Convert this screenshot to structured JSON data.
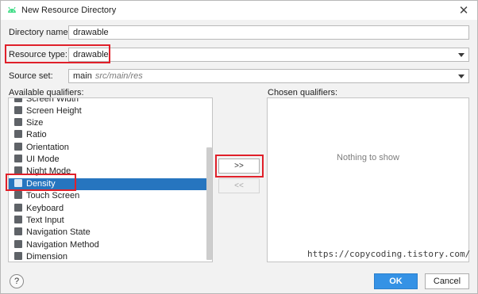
{
  "window": {
    "title": "New Resource Directory",
    "close_glyph": "✕"
  },
  "form": {
    "directory_name": {
      "label": "Directory name:",
      "value": "drawable"
    },
    "resource_type": {
      "label": "Resource type:",
      "value": "drawable"
    },
    "source_set": {
      "label": "Source set:",
      "value": "main",
      "hint": "src/main/res"
    }
  },
  "available": {
    "label": "Available qualifiers:",
    "items": [
      {
        "label": "Screen Width",
        "icon": "screen-width-icon"
      },
      {
        "label": "Screen Height",
        "icon": "screen-height-icon"
      },
      {
        "label": "Size",
        "icon": "size-icon"
      },
      {
        "label": "Ratio",
        "icon": "ratio-icon"
      },
      {
        "label": "Orientation",
        "icon": "orientation-icon"
      },
      {
        "label": "UI Mode",
        "icon": "ui-mode-icon"
      },
      {
        "label": "Night Mode",
        "icon": "night-mode-icon"
      },
      {
        "label": "Density",
        "icon": "density-icon",
        "selected": true
      },
      {
        "label": "Touch Screen",
        "icon": "touch-screen-icon"
      },
      {
        "label": "Keyboard",
        "icon": "keyboard-icon"
      },
      {
        "label": "Text Input",
        "icon": "text-input-icon"
      },
      {
        "label": "Navigation State",
        "icon": "navigation-state-icon"
      },
      {
        "label": "Navigation Method",
        "icon": "navigation-method-icon"
      },
      {
        "label": "Dimension",
        "icon": "dimension-icon"
      }
    ]
  },
  "transfer": {
    "add_label": ">>",
    "remove_label": "<<"
  },
  "chosen": {
    "label": "Chosen qualifiers:",
    "empty_text": "Nothing to show",
    "watermark": "https://copycoding.tistory.com/"
  },
  "footer": {
    "help_label": "?",
    "ok_label": "OK",
    "cancel_label": "Cancel"
  },
  "colors": {
    "selection": "#2675bf",
    "ok_button": "#3592e5",
    "annotation_red": "#e0202a",
    "android_green": "#3ddc84"
  }
}
